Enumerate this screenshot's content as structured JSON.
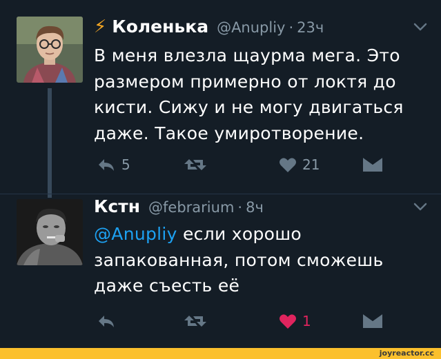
{
  "tweets": [
    {
      "emoji_prefix": "⚡",
      "name": "Коленька",
      "handle": "@Anupliy",
      "separator": "·",
      "time": "23ч",
      "text_lines": [
        "В меня влезла щаурма мега. Это",
        "размером примерно от локтя до",
        "кисти. Сижу и не могу двигаться",
        "даже. Такое умиротворение."
      ],
      "replies": "5",
      "retweets": "",
      "likes": "21",
      "liked": false,
      "avatar_icon": "person-photo-avatar"
    },
    {
      "name": "Кстн",
      "handle": "@febrarium",
      "separator": "·",
      "time": "8ч",
      "mention": "@Anupliy",
      "text_lines": [
        " если хорошо",
        "запакованная, потом сможешь",
        "даже съесть её"
      ],
      "replies": "",
      "retweets": "",
      "likes": "1",
      "liked": true,
      "avatar_icon": "child-photo-avatar"
    }
  ],
  "colors": {
    "background": "#141d26",
    "text": "#ffffff",
    "muted": "#8899a6",
    "link": "#1da1f2",
    "like": "#e0245e",
    "bolt": "#f5a623",
    "footer": "#fbc02d"
  },
  "footer": {
    "watermark": "joyreactor.cc"
  }
}
